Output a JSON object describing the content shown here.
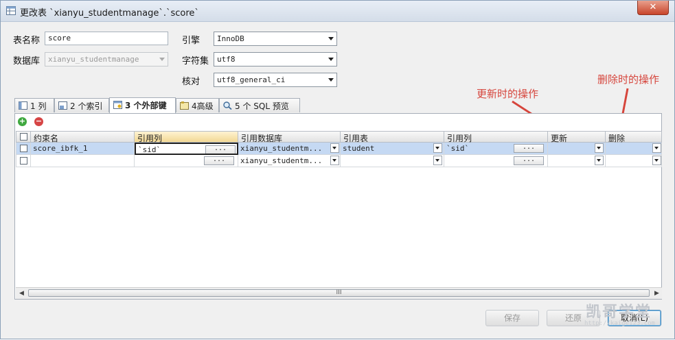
{
  "window": {
    "title": "更改表 `xianyu_studentmanage`.`score`",
    "close_label": "✕"
  },
  "form": {
    "table_name_label": "表名称",
    "table_name_value": "score",
    "database_label": "数据库",
    "database_value": "xianyu_studentmanage",
    "engine_label": "引擎",
    "engine_value": "InnoDB",
    "charset_label": "字符集",
    "charset_value": "utf8",
    "collation_label": "核对",
    "collation_value": "utf8_general_ci"
  },
  "tabs": [
    {
      "label": "1 列"
    },
    {
      "label": "2 个索引"
    },
    {
      "label": "3 个外部键",
      "active": true
    },
    {
      "label": "4高级"
    },
    {
      "label": "5 个 SQL 预览"
    }
  ],
  "grid": {
    "headers": [
      "约束名",
      "引用列",
      "引用数据库",
      "引用表",
      "引用列",
      "更新",
      "删除"
    ],
    "rows": [
      {
        "name": "score_ibfk_1",
        "ref_col": "`sid`",
        "ref_db": "xianyu_studentm...",
        "ref_table": "student",
        "ref_col2": "`sid`",
        "update": "",
        "delete": ""
      },
      {
        "name": "",
        "ref_col": "",
        "ref_db": "xianyu_studentm...",
        "ref_table": "",
        "ref_col2": "",
        "update": "",
        "delete": ""
      }
    ],
    "ellipsis": "...",
    "scroll_grip": "III"
  },
  "buttons": {
    "save": "保存",
    "revert": "还原",
    "cancel": "取消(L)"
  },
  "annotations": {
    "update": "更新时的操作",
    "delete": "删除时的操作",
    "color": "#d6453c"
  },
  "watermark": {
    "text": "凯哥学堂",
    "url": "http://kaige123.com"
  }
}
